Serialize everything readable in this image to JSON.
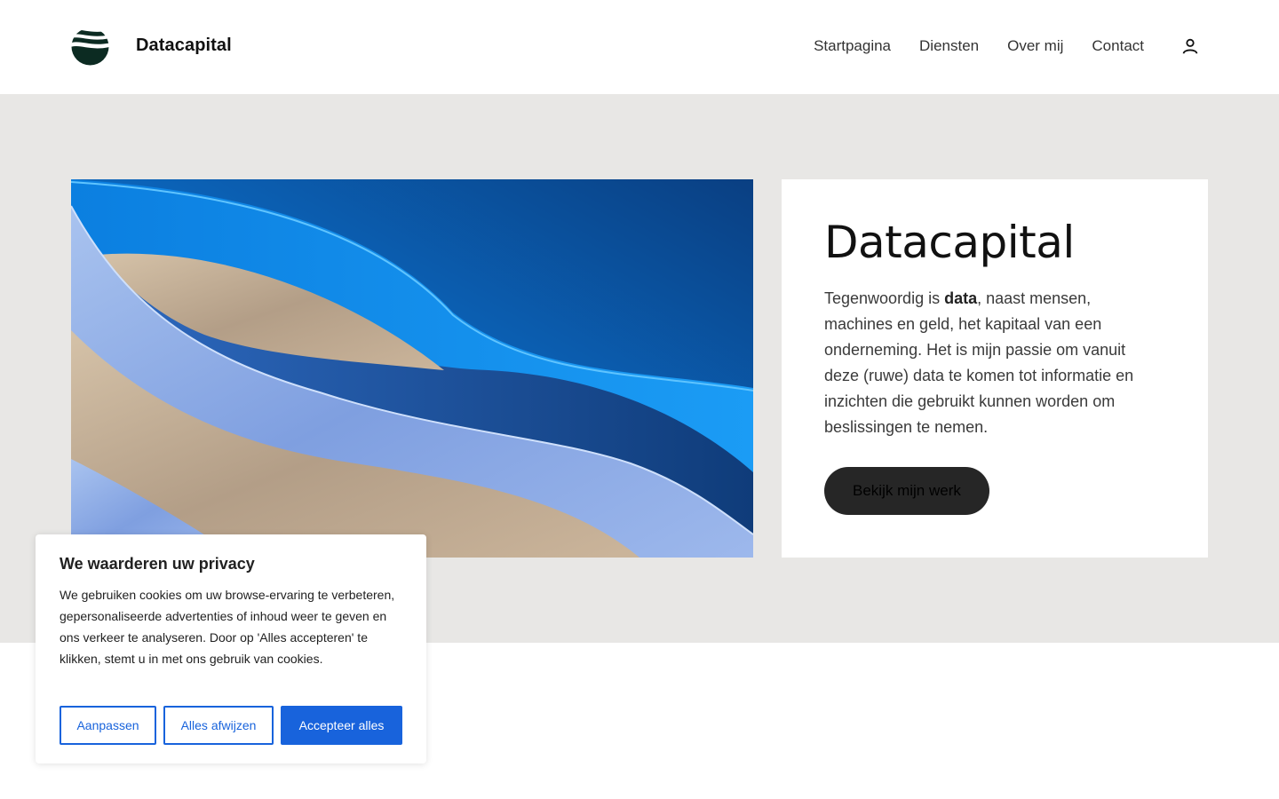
{
  "header": {
    "brand": "Datacapital",
    "nav": [
      "Startpagina",
      "Diensten",
      "Over mij",
      "Contact"
    ]
  },
  "hero": {
    "title": "Datacapital",
    "text_before": "Tegenwoordig is ",
    "text_bold": "data",
    "text_after": ", naast mensen, machines en geld, het kapitaal van een onderneming. Het is mijn passie om vanuit deze (ruwe) data te komen tot informatie en inzichten die gebruikt kunnen worden om beslissingen te nemen.",
    "cta": "Bekijk mijn werk"
  },
  "cookie": {
    "title": "We waarderen uw privacy",
    "text": "We gebruiken cookies om uw browse-ervaring te verbeteren, gepersonaliseerde advertenties of inhoud weer te geven en ons verkeer te analyseren. Door op 'Alles accepteren' te klikken, stemt u in met ons gebruik van cookies.",
    "buttons": {
      "customize": "Aanpassen",
      "reject": "Alles afwijzen",
      "accept": "Accepteer alles"
    }
  },
  "icons": {
    "logo": "logo-waves-icon",
    "account": "user-icon"
  },
  "colors": {
    "hero_background": "#e8e7e5",
    "cta_background": "#262626",
    "cookie_accent": "#1863dc"
  }
}
